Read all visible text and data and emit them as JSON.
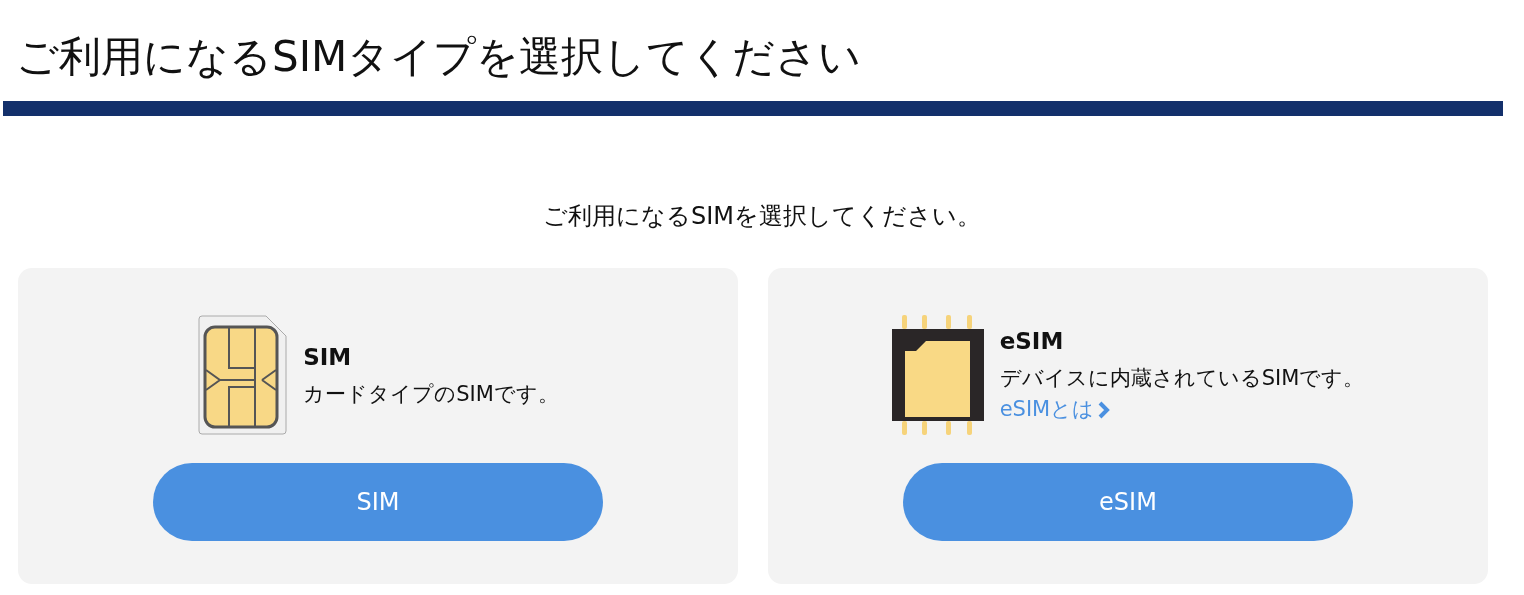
{
  "page_title": "ご利用になるSIMタイプを選択してください",
  "subtitle": "ご利用になるSIMを選択してください。",
  "cards": [
    {
      "kind": "sim",
      "name": "SIM",
      "description": "カードタイプのSIMです。",
      "button": "SIM"
    },
    {
      "kind": "esim",
      "name": "eSIM",
      "description": "デバイスに内蔵されているSIMです。",
      "link": "eSIMとは",
      "button": "eSIM"
    }
  ]
}
